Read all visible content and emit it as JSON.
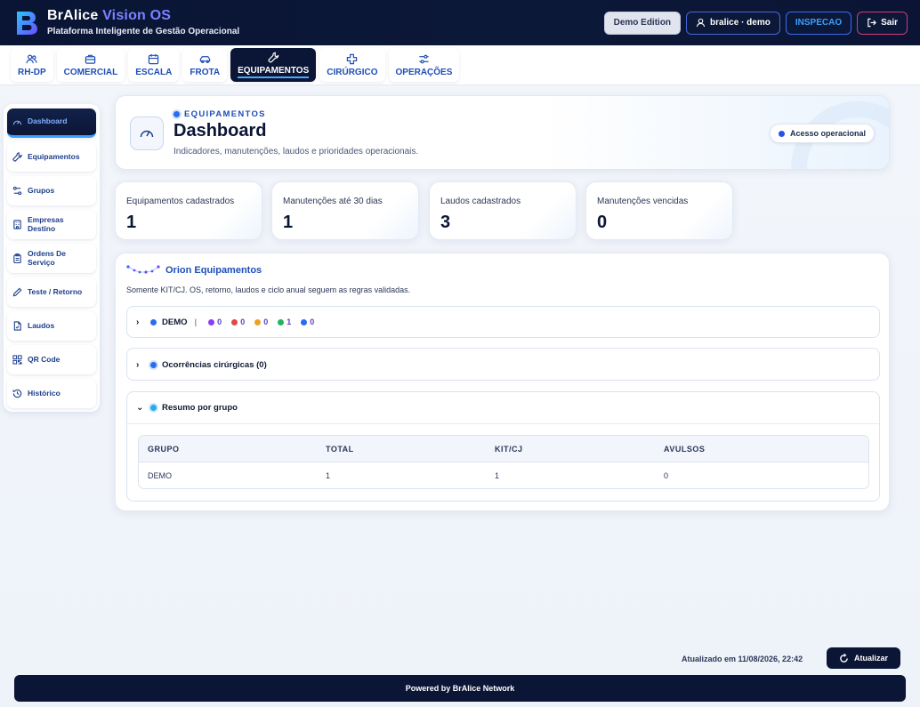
{
  "header": {
    "brand_main": "BrAlice",
    "brand_accent": "Vision OS",
    "subtitle": "Plataforma Inteligente de Gestão Operacional",
    "demo_label": "Demo Edition",
    "user_label": "bralice · demo",
    "role_label": "INSPECAO",
    "exit_label": "Sair"
  },
  "modules": [
    {
      "label": "RH-DP",
      "icon": "users-icon"
    },
    {
      "label": "COMERCIAL",
      "icon": "briefcase-icon"
    },
    {
      "label": "ESCALA",
      "icon": "calendar-icon"
    },
    {
      "label": "FROTA",
      "icon": "car-icon"
    },
    {
      "label": "EQUIPAMENTOS",
      "icon": "wrench-icon",
      "active": true
    },
    {
      "label": "CIRÚRGICO",
      "icon": "plus-icon"
    },
    {
      "label": "OPERAÇÕES",
      "icon": "settings-sliders-icon"
    }
  ],
  "sidebar": {
    "items": [
      {
        "label": "Dashboard",
        "icon": "gauge-icon",
        "active": true
      },
      {
        "label": "Equipamentos",
        "icon": "wrench-icon"
      },
      {
        "label": "Grupos",
        "icon": "group-icon"
      },
      {
        "label": "Empresas Destino",
        "icon": "building-icon"
      },
      {
        "label": "Ordens De Serviço",
        "icon": "clipboard-icon"
      },
      {
        "label": "Teste / Retorno",
        "icon": "pencil-icon"
      },
      {
        "label": "Laudos",
        "icon": "document-icon"
      },
      {
        "label": "QR Code",
        "icon": "qrcode-icon"
      },
      {
        "label": "Histórico",
        "icon": "history-icon"
      }
    ]
  },
  "hero": {
    "kicker": "EQUIPAMENTOS",
    "title": "Dashboard",
    "description": "Indicadores, manutenções, laudos e prioridades operacionais.",
    "badge": "Acesso operacional"
  },
  "kpis": [
    {
      "label": "Equipamentos cadastrados",
      "value": "1"
    },
    {
      "label": "Manutenções até 30 dias",
      "value": "1"
    },
    {
      "label": "Laudos cadastrados",
      "value": "3"
    },
    {
      "label": "Manutenções vencidas",
      "value": "0"
    }
  ],
  "orion": {
    "title": "Orion Equipamentos",
    "subtitle": "Somente KIT/CJ. OS, retorno, laudos e ciclo anual seguem as regras validadas.",
    "demo_row": {
      "label": "DEMO",
      "counts": [
        {
          "value": "0",
          "color": "#8a3ff0"
        },
        {
          "value": "0",
          "color": "#e04848"
        },
        {
          "value": "0",
          "color": "#f0a020"
        },
        {
          "value": "1",
          "color": "#22b460"
        },
        {
          "value": "0",
          "color": "#2a6cf0"
        }
      ]
    },
    "surgical_label": "Ocorrências cirúrgicas (0)",
    "summary_label": "Resumo por grupo",
    "table": {
      "headers": [
        "GRUPO",
        "TOTAL",
        "KIT/CJ",
        "AVULSOS"
      ],
      "rows": [
        [
          "DEMO",
          "1",
          "1",
          "0"
        ]
      ]
    }
  },
  "updated_text": "Atualizado em 11/08/2026, 22:42",
  "refresh_label": "Atualizar",
  "footer_text": "Powered by BrAlice Network"
}
